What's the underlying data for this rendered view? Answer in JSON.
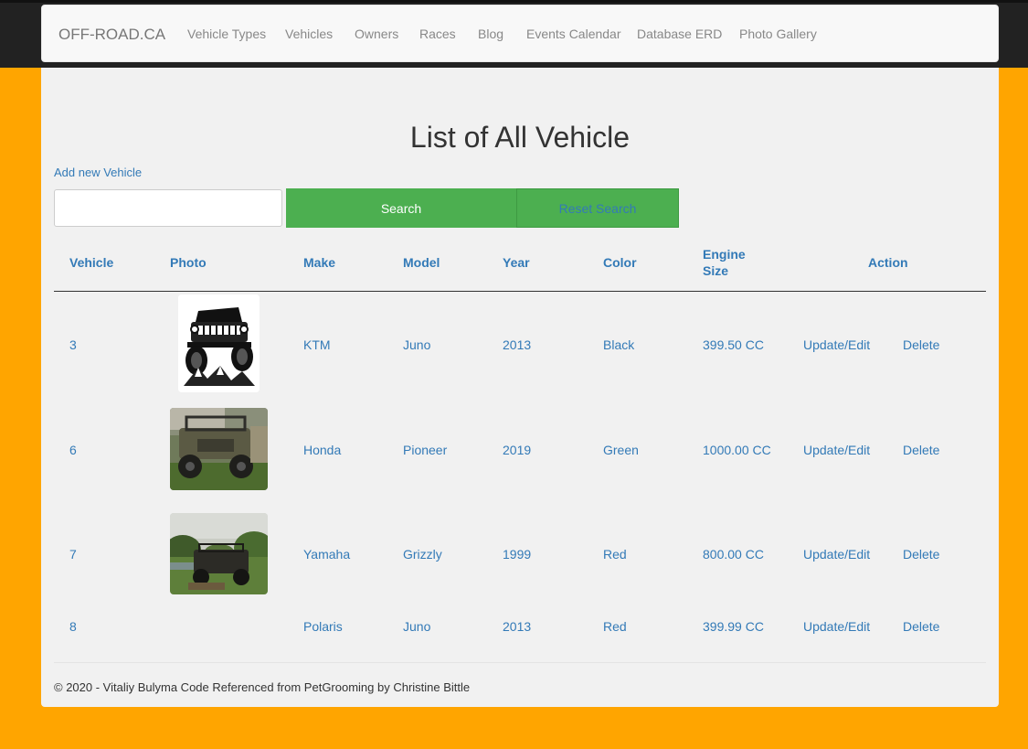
{
  "brand": "OFF-ROAD.CA",
  "nav": [
    "Vehicle Types",
    "Vehicles",
    "Owners",
    "Races",
    "Blog",
    "Events Calendar",
    "Database ERD",
    "Photo Gallery"
  ],
  "page_title": "List of All Vehicle",
  "add_link": "Add new Vehicle",
  "search": {
    "placeholder": "",
    "button": "Search",
    "reset": "Reset Search"
  },
  "columns": [
    "Vehicle",
    "Photo",
    "Make",
    "Model",
    "Year",
    "Color",
    "Engine Size",
    "Action"
  ],
  "rows": [
    {
      "id": "3",
      "photo": "jeep-drawing-icon",
      "make": "KTM",
      "model": "Juno",
      "year": "2013",
      "color": "Black",
      "engine": "399.50 CC",
      "edit": "Update/Edit",
      "delete": "Delete"
    },
    {
      "id": "6",
      "photo": "utv-photo",
      "make": "Honda",
      "model": "Pioneer",
      "year": "2019",
      "color": "Green",
      "engine": "1000.00 CC",
      "edit": "Update/Edit",
      "delete": "Delete"
    },
    {
      "id": "7",
      "photo": "atv-field-photo",
      "make": "Yamaha",
      "model": "Grizzly",
      "year": "1999",
      "color": "Red",
      "engine": "800.00 CC",
      "edit": "Update/Edit",
      "delete": "Delete"
    },
    {
      "id": "8",
      "photo": "",
      "make": "Polaris",
      "model": "Juno",
      "year": "2013",
      "color": "Red",
      "engine": "399.99 CC",
      "edit": "Update/Edit",
      "delete": "Delete"
    }
  ],
  "footer": "© 2020 - Vitaliy Bulyma Code Referenced from PetGrooming by Christine Bittle",
  "colors": {
    "background": "#ffa500",
    "navbar": "#222222",
    "button": "#4caf50",
    "link": "#337ab7"
  }
}
